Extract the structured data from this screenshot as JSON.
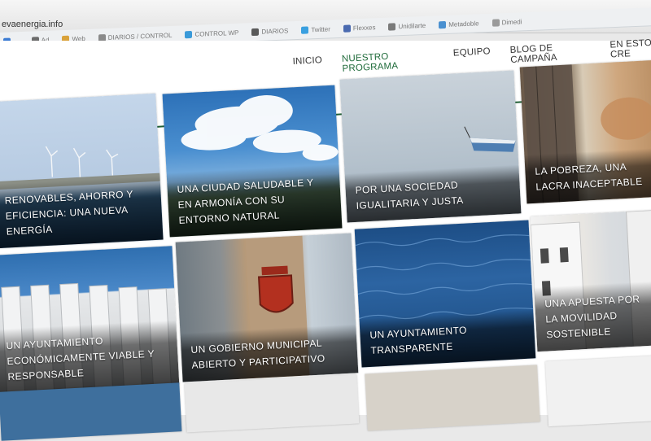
{
  "browser": {
    "url": "evaenergia.info",
    "bookmarks": [
      "...",
      "Ad",
      "Web",
      "DIARIOS / CONTROL",
      "CONTROL WP",
      "DIARIOS",
      "Twitter",
      "Flexxes",
      "Unidilarte",
      "Metadoble",
      "Dimedi"
    ]
  },
  "nav": {
    "items": [
      "INICIO",
      "NUESTRO PROGRAMA",
      "EQUIPO",
      "BLOG DE CAMPAÑA",
      "EN ESTO CRE"
    ],
    "active_index": 1,
    "colors": {
      "active": "#1f6b3a",
      "rule": "#1f5f35"
    }
  },
  "tiles": [
    {
      "caption": "RENOVABLES, AHORRO Y EFICIENCIA: UNA NUEVA ENERGÍA",
      "scene": "wind-turbines-icon"
    },
    {
      "caption": "UNA CIUDAD SALUDABLE Y EN ARMONÍA CON SU ENTORNO NATURAL",
      "scene": "clouds-sky-icon"
    },
    {
      "caption": "POR UNA SOCIEDAD IGUALITARIA Y JUSTA",
      "scene": "boat-icon"
    },
    {
      "caption": "LA POBREZA, UNA LACRA INACEPTABLE",
      "scene": "old-wall-icon"
    },
    {
      "caption": "UN AYUNTAMIENTO ECONÓMICAMENTE VIABLE Y RESPONSABLE",
      "scene": "columns-building-icon"
    },
    {
      "caption": "UN GOBIERNO MUNICIPAL ABIERTO Y PARTICIPATIVO",
      "scene": "coat-of-arms-icon"
    },
    {
      "caption": "UN AYUNTAMIENTO TRANSPARENTE",
      "scene": "water-icon"
    },
    {
      "caption": "UNA APUESTA POR LA MOVILIDAD SOSTENIBLE",
      "scene": "street-icon"
    }
  ]
}
